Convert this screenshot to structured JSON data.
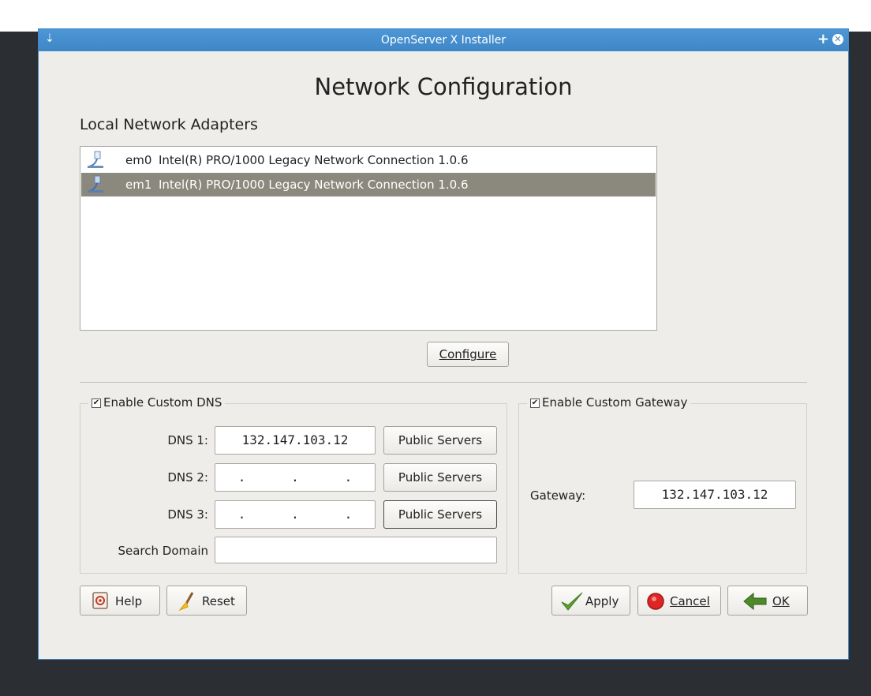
{
  "window": {
    "title": "OpenServer X Installer"
  },
  "page": {
    "title": "Network Configuration",
    "subtitle": "Local Network Adapters"
  },
  "adapters": [
    {
      "name": "em0",
      "description": "Intel(R) PRO/1000 Legacy Network Connection 1.0.6",
      "selected": false
    },
    {
      "name": "em1",
      "description": "Intel(R) PRO/1000 Legacy Network Connection 1.0.6",
      "selected": true
    }
  ],
  "configure_label": "Configure",
  "dns": {
    "enable_label": "Enable Custom DNS",
    "enabled": true,
    "dns1_label": "DNS 1:",
    "dns1_value": "132.147.103.12",
    "dns2_label": "DNS 2:",
    "dns2_value": ".      .      .",
    "dns3_label": "DNS 3:",
    "dns3_value": ".      .      .",
    "public_servers_label": "Public Servers",
    "search_domain_label": "Search Domain",
    "search_domain_value": ""
  },
  "gateway": {
    "enable_label": "Enable Custom Gateway",
    "enabled": true,
    "label": "Gateway:",
    "value": "132.147.103.12"
  },
  "buttons": {
    "help": "Help",
    "reset": "Reset",
    "apply": "Apply",
    "cancel": "Cancel",
    "ok": "OK"
  },
  "colors": {
    "titlebar": "#3f86c6",
    "selection": "#8b897d",
    "window_bg": "#efedea"
  }
}
